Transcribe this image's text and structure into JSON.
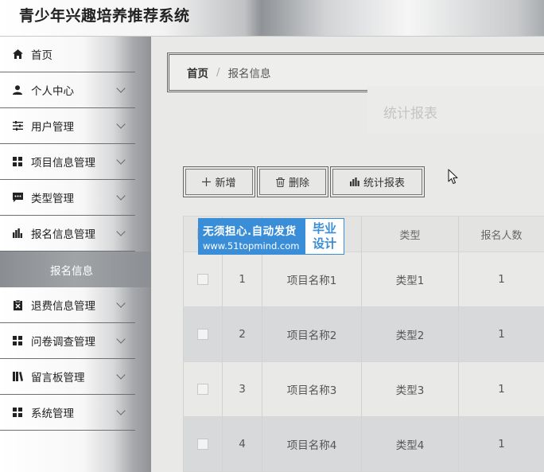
{
  "app": {
    "title": "青少年兴趣培养推荐系统"
  },
  "sidebar": {
    "items": [
      {
        "label": "首页",
        "icon": "home-icon",
        "expandable": false
      },
      {
        "label": "个人中心",
        "icon": "user-icon",
        "expandable": true
      },
      {
        "label": "用户管理",
        "icon": "sliders-icon",
        "expandable": true
      },
      {
        "label": "项目信息管理",
        "icon": "grid-icon",
        "expandable": true
      },
      {
        "label": "类型管理",
        "icon": "comment-icon",
        "expandable": true
      },
      {
        "label": "报名信息管理",
        "icon": "bar-chart-icon",
        "expandable": true
      },
      {
        "label": "退费信息管理",
        "icon": "clipboard-x-icon",
        "expandable": true
      },
      {
        "label": "问卷调查管理",
        "icon": "grid-icon",
        "expandable": true
      },
      {
        "label": "留言板管理",
        "icon": "book-icon",
        "expandable": true
      },
      {
        "label": "系统管理",
        "icon": "grid-icon",
        "expandable": true
      }
    ],
    "active_sub": "报名信息"
  },
  "breadcrumb": {
    "home": "首页",
    "separator": "/",
    "current": "报名信息"
  },
  "ghost_title": "统计报表",
  "toolbar": {
    "add_label": "新增",
    "delete_label": "删除",
    "stats_label": "统计报表"
  },
  "table": {
    "columns": [
      "",
      "",
      "",
      "类型",
      "报名人数"
    ],
    "rows": [
      {
        "index": "1",
        "name": "项目名称1",
        "type": "类型1",
        "count": "1"
      },
      {
        "index": "2",
        "name": "项目名称2",
        "type": "类型2",
        "count": "1"
      },
      {
        "index": "3",
        "name": "项目名称3",
        "type": "类型3",
        "count": "1"
      },
      {
        "index": "4",
        "name": "项目名称4",
        "type": "类型4",
        "count": "1"
      }
    ]
  },
  "watermark": {
    "line1": "无须担心.自动发货",
    "line2": "www.51topmind.com",
    "badge1": "毕业",
    "badge2": "设计"
  },
  "colors": {
    "watermark_blue": "#3a8ed8",
    "submenu_active": "#9a9da1"
  }
}
